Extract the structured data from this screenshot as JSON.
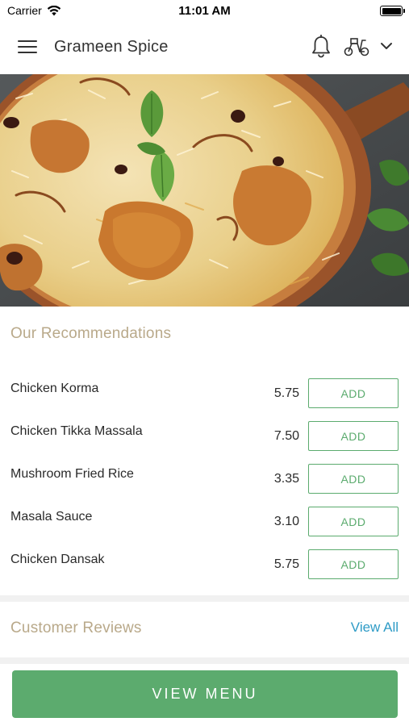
{
  "status_bar": {
    "carrier": "Carrier",
    "time": "11:01 AM"
  },
  "header": {
    "title": "Grameen Spice",
    "icons": [
      "menu-icon",
      "bell-icon",
      "scooter-icon",
      "chevron-down-icon"
    ]
  },
  "recommendations": {
    "title": "Our Recommendations",
    "add_label": "ADD",
    "items": [
      {
        "name": "Chicken Korma",
        "price": "5.75"
      },
      {
        "name": "Chicken Tikka Massala",
        "price": "7.50"
      },
      {
        "name": "Mushroom Fried Rice",
        "price": "3.35"
      },
      {
        "name": "Masala Sauce",
        "price": "3.10"
      },
      {
        "name": "Chicken Dansak",
        "price": "5.75"
      }
    ]
  },
  "reviews": {
    "title": "Customer Reviews",
    "view_all": "View All"
  },
  "footer": {
    "button_label": "VIEW MENU"
  },
  "colors": {
    "accent_green": "#5bab6e",
    "section_title": "#b9a98a",
    "link_blue": "#2e9bc6"
  }
}
